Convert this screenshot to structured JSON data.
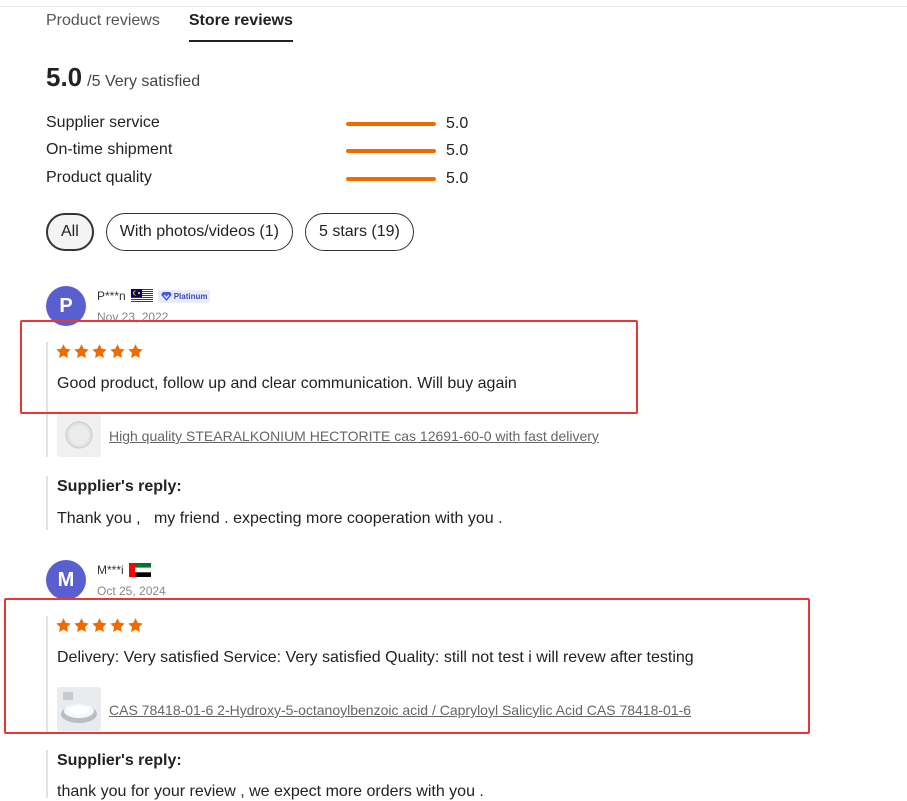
{
  "tabs": [
    {
      "label": "Product reviews",
      "active": false
    },
    {
      "label": "Store reviews",
      "active": true
    }
  ],
  "summary": {
    "score": "5.0",
    "suffix": "/5 Very satisfied"
  },
  "metrics": [
    {
      "label": "Supplier service",
      "value": "5.0",
      "fill_fraction": 1.0
    },
    {
      "label": "On-time shipment",
      "value": "5.0",
      "fill_fraction": 1.0
    },
    {
      "label": "Product quality",
      "value": "5.0",
      "fill_fraction": 1.0
    }
  ],
  "filters": [
    {
      "label": "All",
      "active": true
    },
    {
      "label": "With photos/videos (1)",
      "active": false
    },
    {
      "label": "5 stars (19)",
      "active": false
    }
  ],
  "reviews": [
    {
      "avatar_letter": "P",
      "name": "P***n",
      "country_flag": "malaysia-flag-icon",
      "badge": "Platinum",
      "date": "Nov 23, 2022",
      "rating": 5,
      "text": "Good product, follow up and clear communication. Will buy again",
      "product": "High quality STEARALKONIUM HECTORITE cas 12691-60-0 with fast delivery",
      "product_thumb_icon": "white-tablet-icon",
      "reply_header": "Supplier's reply:",
      "reply_text": "Thank you ,   my friend . expecting more cooperation with you ."
    },
    {
      "avatar_letter": "M",
      "name": "M***i",
      "country_flag": "uae-flag-icon",
      "date": "Oct 25, 2024",
      "rating": 5,
      "text": "Delivery: Very satisfied Service: Very satisfied Quality: still not test i will revew after testing",
      "product": "CAS 78418-01-6 2-Hydroxy-5-octanoylbenzoic acid / Capryloyl Salicylic Acid CAS 78418-01-6",
      "product_thumb_icon": "powder-dish-icon",
      "reply_header": "Supplier's reply:",
      "reply_text": "thank you for your review , we expect more orders with you ."
    }
  ],
  "colors": {
    "accent": "#f06a00",
    "avatar": "#5a5fd0",
    "highlight_box": "#e53935"
  }
}
